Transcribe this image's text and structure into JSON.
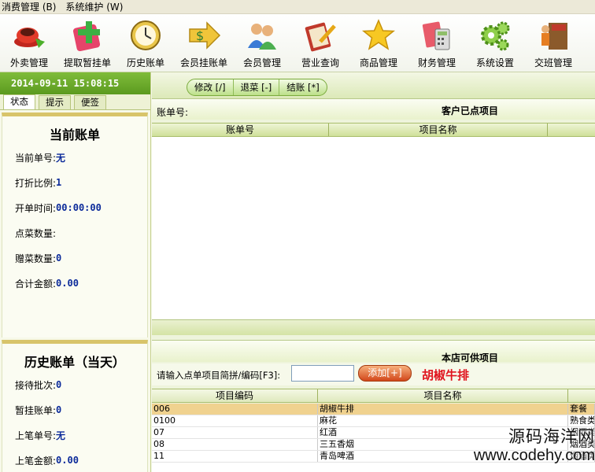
{
  "menu": [
    "消费管理 (B)",
    "系统维护 (W)"
  ],
  "toolbar": [
    {
      "label": "外卖管理",
      "icon": "takeout-icon"
    },
    {
      "label": "提取暂挂单",
      "icon": "retrieve-pending-icon"
    },
    {
      "label": "历史账单",
      "icon": "history-clock-icon"
    },
    {
      "label": "会员挂账单",
      "icon": "member-credit-icon"
    },
    {
      "label": "会员管理",
      "icon": "members-icon"
    },
    {
      "label": "营业查询",
      "icon": "business-query-icon"
    },
    {
      "label": "商品管理",
      "icon": "product-star-icon"
    },
    {
      "label": "财务管理",
      "icon": "finance-calculator-icon"
    },
    {
      "label": "系统设置",
      "icon": "settings-gears-icon"
    },
    {
      "label": "交班管理",
      "icon": "shift-exit-icon"
    }
  ],
  "left": {
    "datetime": "2014-09-11 15:08:15",
    "tabs": [
      "状态",
      "提示",
      "便签"
    ],
    "current": {
      "title": "当前账单",
      "rows": [
        {
          "label": "当前单号:",
          "value": "无"
        },
        {
          "label": "打折比例:",
          "value": "1"
        },
        {
          "label": "开单时间:",
          "value": "00:00:00"
        },
        {
          "label": "点菜数量:",
          "value": ""
        },
        {
          "label": "赠菜数量:",
          "value": "0"
        },
        {
          "label": "合计金额:",
          "value": "0.00"
        }
      ]
    },
    "history": {
      "title": "历史账单（当天）",
      "rows": [
        {
          "label": "接待批次:",
          "value": "0"
        },
        {
          "label": "暂挂账单:",
          "value": "0"
        },
        {
          "label": "上笔单号:",
          "value": "无"
        },
        {
          "label": "上笔金额:",
          "value": "0.00"
        }
      ]
    }
  },
  "orders": {
    "buttons": [
      "修改 [/]",
      "退菜 [-]",
      "结账 [*]"
    ],
    "account_label": "账单号:",
    "title": "客户已点项目",
    "columns": [
      "账单号",
      "项目名称"
    ]
  },
  "menu_items": {
    "title": "本店可供项目",
    "prompt": "请输入点单项目简拼/编码[F3]:",
    "input_value": "",
    "add_button": "添加[+]",
    "selected_name": "胡椒牛排",
    "columns": [
      "项目编码",
      "项目名称",
      ""
    ],
    "rows": [
      {
        "code": "006",
        "name": "胡椒牛排",
        "type": "套餐"
      },
      {
        "code": "0100",
        "name": "麻花",
        "type": "熟食类"
      },
      {
        "code": "07",
        "name": "红酒",
        "type": "烟酒类"
      },
      {
        "code": "08",
        "name": "三五香烟",
        "type": "烟酒类"
      },
      {
        "code": "11",
        "name": "青岛啤酒",
        "type": "烟酒类"
      }
    ]
  },
  "watermark": {
    "line1": "源码海洋网",
    "line2": "www.codehy.com"
  },
  "colors": {
    "accent_green": "#5b9a1f",
    "value_blue": "#0b2a9a",
    "highlight_red": "#e0141e",
    "selected_row": "#f0d28f"
  }
}
